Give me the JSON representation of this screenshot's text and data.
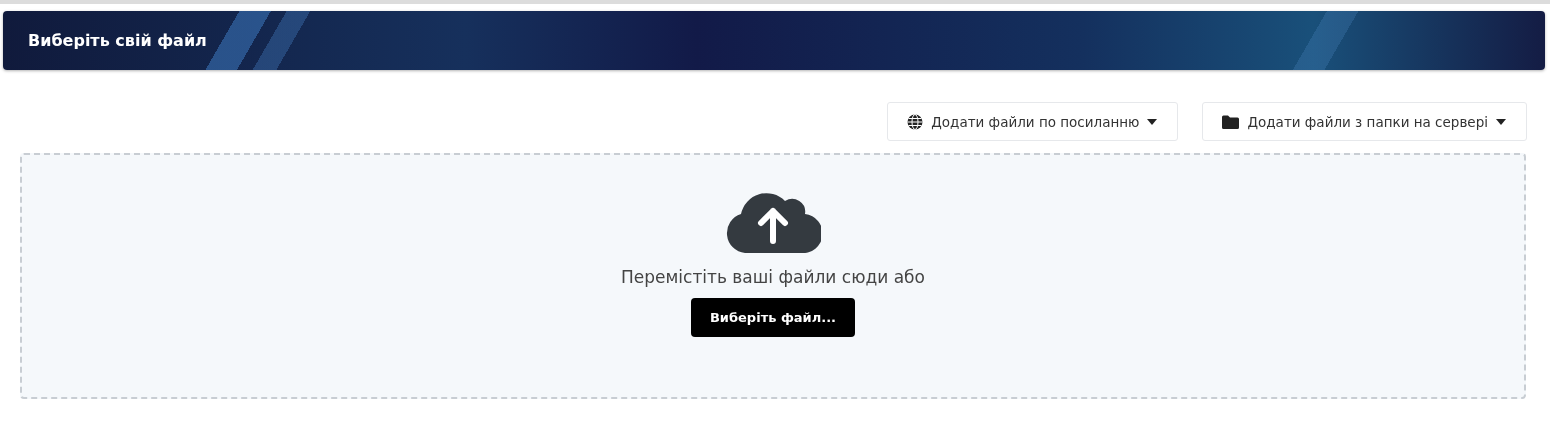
{
  "header": {
    "title": "Виберіть свій файл"
  },
  "actions": [
    {
      "label": "Додати файли по посиланню",
      "kind": "link"
    },
    {
      "label": "Додати файли з папки на сервері",
      "kind": "server"
    }
  ],
  "dropzone": {
    "prompt": "Перемістіть ваші файли сюди або",
    "button": "Виберіть файл..."
  }
}
